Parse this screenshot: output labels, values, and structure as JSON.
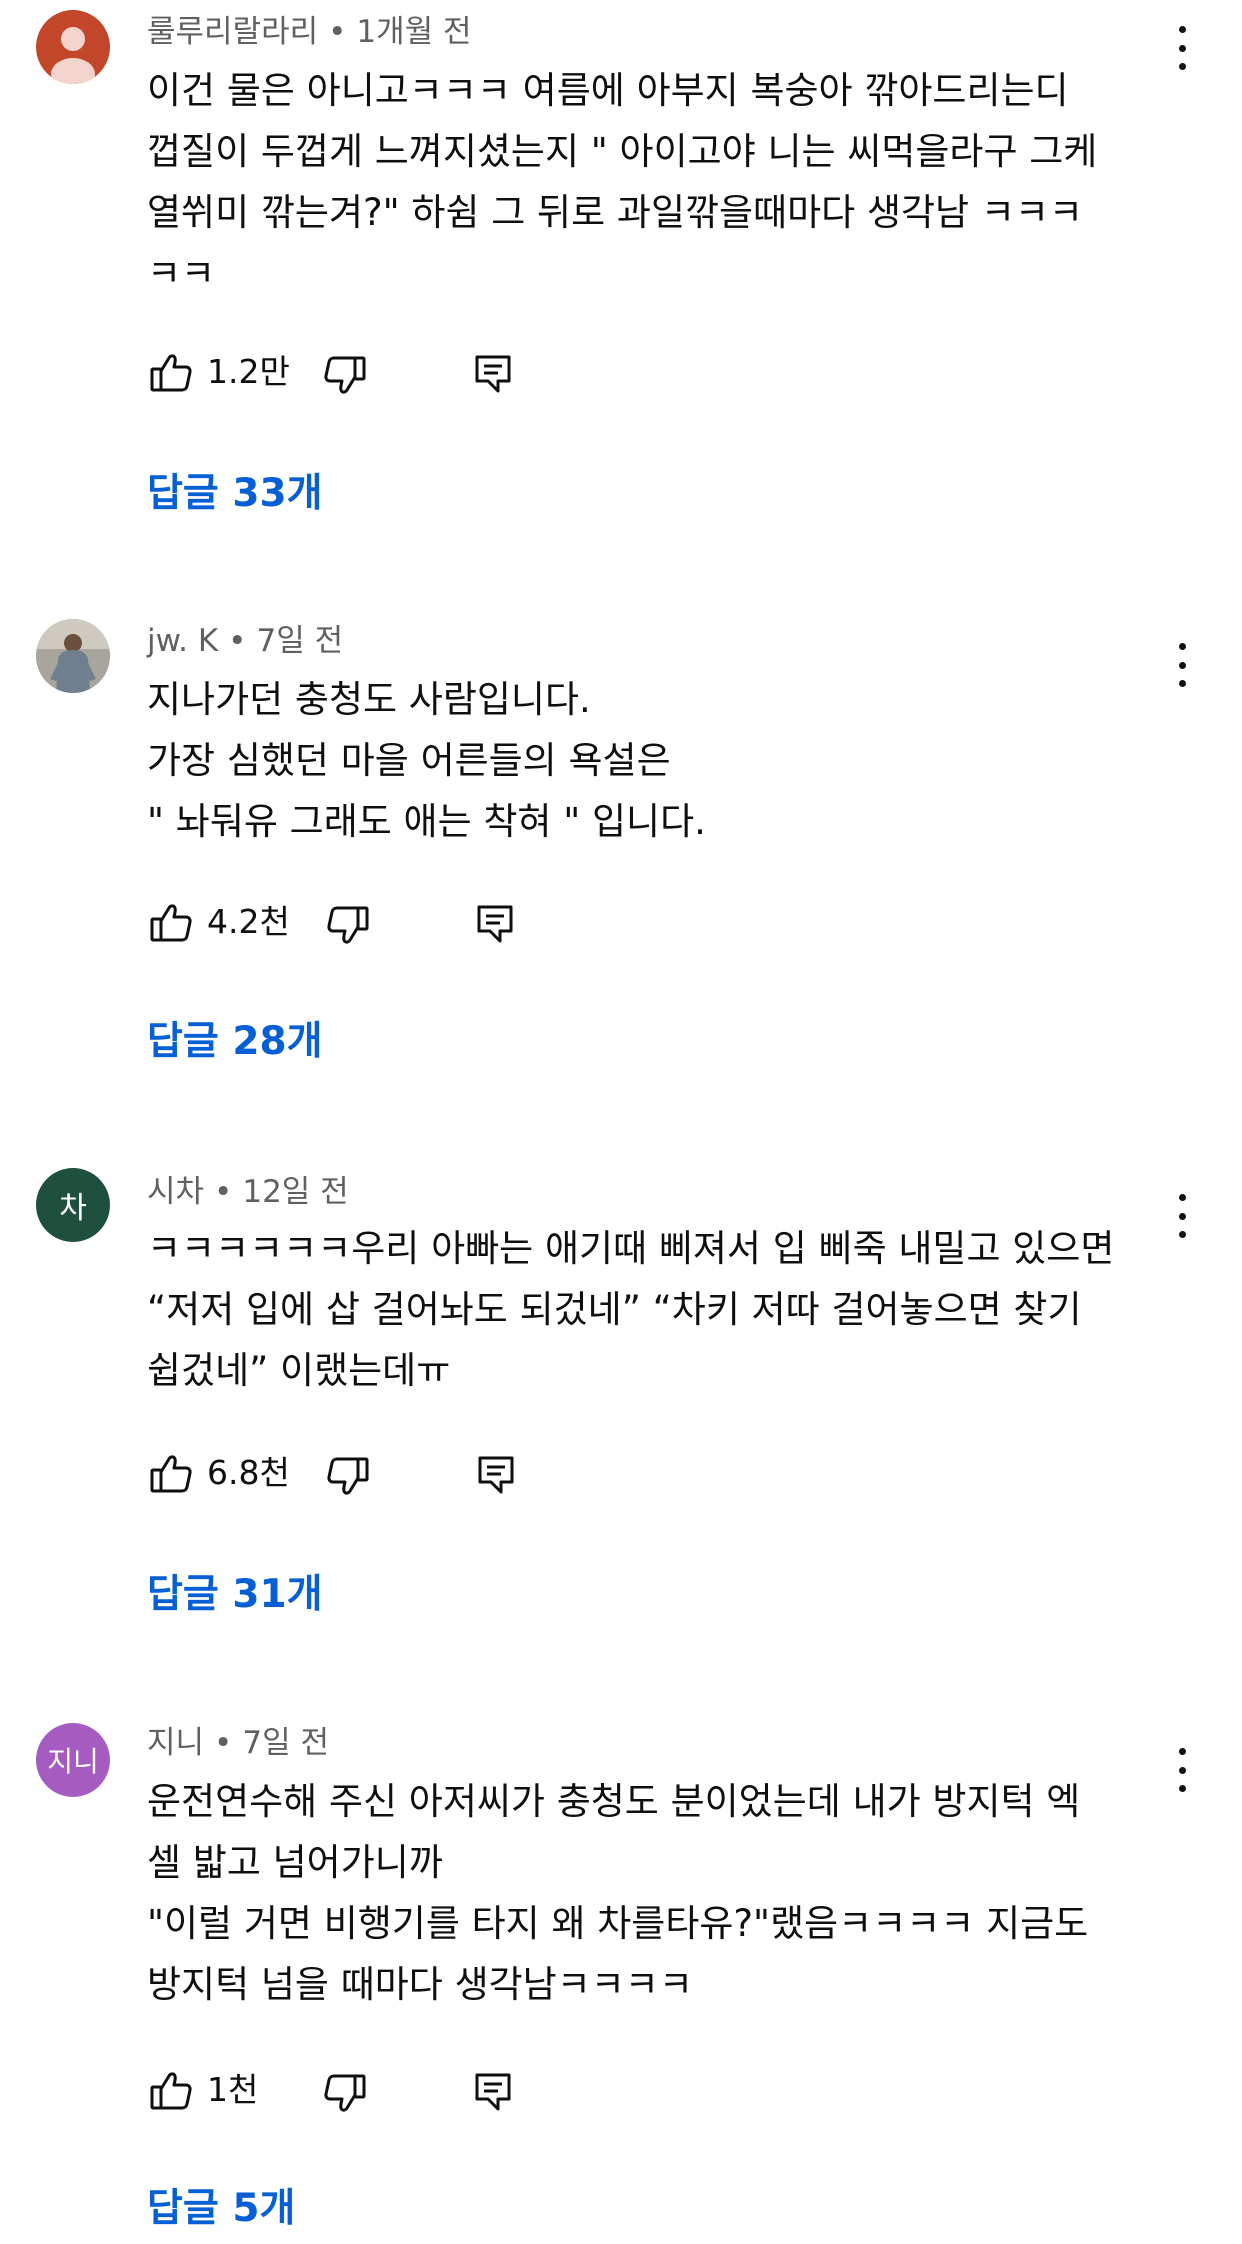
{
  "comments": [
    {
      "author": "룰루리랄라리",
      "time": "1개월 전",
      "avatar_text": "",
      "lines": [
        "이건 물은 아니고ㅋㅋㅋ 여름에 아부지 복숭아 깎아드리는디",
        "껍질이 두껍게 느껴지셨는지 \" 아이고야 니는 씨먹을라구 그케",
        "열쒸미 깎는겨?\" 하쉼 그 뒤로 과일깎을때마다 생각남 ㅋㅋㅋ",
        "ㅋㅋ"
      ],
      "likes": "1.2만",
      "replies": "답글 33개"
    },
    {
      "author": "jw. K",
      "time": "7일 전",
      "avatar_text": "",
      "lines": [
        "지나가던 충청도 사람입니다.",
        "가장 심했던 마을 어른들의 욕설은",
        "\" 놔둬유 그래도 애는 착혀 \" 입니다."
      ],
      "likes": "4.2천",
      "replies": "답글 28개"
    },
    {
      "author": "시차",
      "time": "12일 전",
      "avatar_text": "차",
      "lines": [
        "ㅋㅋㅋㅋㅋㅋ우리 아빠는 애기때 삐져서 입 삐죽 내밀고 있으면",
        "“저저 입에 삽 걸어놔도 되겄네” “차키 저따 걸어놓으면 찾기",
        "쉽겄네” 이랬는데ㅠ"
      ],
      "likes": "6.8천",
      "replies": "답글 31개"
    },
    {
      "author": "지니",
      "time": "7일 전",
      "avatar_text": "지니",
      "lines": [
        "운전연수해 주신 아저씨가 충청도 분이었는데 내가 방지턱 엑",
        "셀 밟고 넘어가니까",
        "\"이럴 거면 비행기를 타지 왜 차를타유?\"랬음ㅋㅋㅋㅋ 지금도",
        "방지턱 넘을 때마다 생각남ㅋㅋㅋㅋ"
      ],
      "likes": "1천",
      "replies": "답글 5개"
    }
  ],
  "icons": {
    "like": "thumbs-up-icon",
    "dislike": "thumbs-down-icon",
    "reply": "reply-comment-icon",
    "menu": "more-vert-icon"
  },
  "colors": {
    "reply_link": "#065fd4",
    "meta_text": "#606060",
    "avatar_1": "#c2472a",
    "avatar_3": "#1f4f3d",
    "avatar_4": "#a55bc0"
  }
}
